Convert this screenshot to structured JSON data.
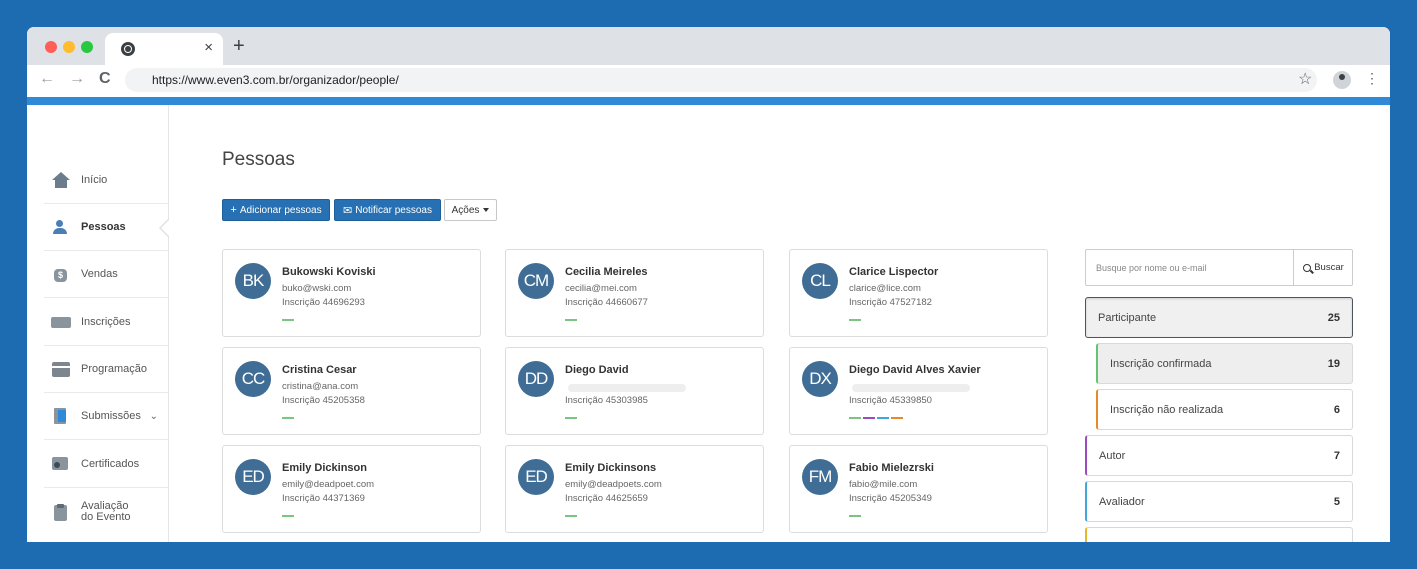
{
  "browser": {
    "tab_close": "×",
    "new_tab": "+",
    "back": "←",
    "forward": "→",
    "reload": "C",
    "url": "https://www.even3.com.br/organizador/people/",
    "bookmark": "☆",
    "menu": "⋮"
  },
  "sidebar": {
    "items": [
      {
        "label": "Início",
        "icon": "house-icon"
      },
      {
        "label": "Pessoas",
        "icon": "people-icon"
      },
      {
        "label": "Vendas",
        "icon": "money-bag-icon"
      },
      {
        "label": "Inscrições",
        "icon": "ticket-icon"
      },
      {
        "label": "Programação",
        "icon": "calendar-icon"
      },
      {
        "label": "Submissões",
        "icon": "document-icon",
        "chevron": "⌄"
      },
      {
        "label": "Certificados",
        "icon": "certificate-icon"
      },
      {
        "label": "Avaliação",
        "label2": "do Evento",
        "icon": "clipboard-icon"
      }
    ]
  },
  "main": {
    "title": "Pessoas",
    "buttons": {
      "add": "Adicionar pessoas",
      "add_glyph": "+",
      "notify": "Notificar pessoas",
      "notify_glyph": "✉",
      "actions": "Ações"
    }
  },
  "people": [
    {
      "initials": "BK",
      "name": "Bukowski Koviski",
      "email": "buko@wski.com",
      "registration": "Inscrição 44696293",
      "tags": [
        "#7cc483"
      ]
    },
    {
      "initials": "CM",
      "name": "Cecilia Meireles",
      "email": "cecilia@mei.com",
      "registration": "Inscrição 44660677",
      "tags": [
        "#7cc483"
      ]
    },
    {
      "initials": "CL",
      "name": "Clarice Lispector",
      "email": "clarice@lice.com",
      "registration": "Inscrição 47527182",
      "tags": [
        "#7cc483"
      ]
    },
    {
      "initials": "CC",
      "name": "Cristina Cesar",
      "email": "cristina@ana.com",
      "registration": "Inscrição 45205358",
      "tags": [
        "#7cc483"
      ]
    },
    {
      "initials": "DD",
      "name": "Diego David",
      "email": "",
      "registration": "Inscrição 45303985",
      "tags": [
        "#7cc483"
      ]
    },
    {
      "initials": "DX",
      "name": "Diego David Alves Xavier",
      "email": "",
      "registration": "Inscrição 45339850",
      "tags": [
        "#7cc483",
        "#9b4bbf",
        "#42a6d9",
        "#e58a2b"
      ]
    },
    {
      "initials": "ED",
      "name": "Emily Dickinson",
      "email": "emily@deadpoet.com",
      "registration": "Inscrição 44371369",
      "tags": [
        "#7cc483"
      ]
    },
    {
      "initials": "ED",
      "name": "Emily Dickinsons",
      "email": "emily@deadpoets.com",
      "registration": "Inscrição 44625659",
      "tags": [
        "#7cc483"
      ]
    },
    {
      "initials": "FM",
      "name": "Fabio Mielezrski",
      "email": "fabio@mile.com",
      "registration": "Inscrição 45205349",
      "tags": [
        "#7cc483"
      ]
    }
  ],
  "filters": {
    "search_placeholder": "Busque por nome ou e-mail",
    "search_button": "Buscar",
    "categories": [
      {
        "label": "Participante",
        "count": "25"
      },
      {
        "label": "Inscrição confirmada",
        "count": "19"
      },
      {
        "label": "Inscrição não realizada",
        "count": "6"
      },
      {
        "label": "Autor",
        "count": "7"
      },
      {
        "label": "Avaliador",
        "count": "5"
      }
    ]
  },
  "colors": {
    "page_background": "#1d6bb0",
    "primary_button": "#2670b3",
    "avatar": "#3f6d95",
    "accent_bar": "#2f8ad8"
  }
}
